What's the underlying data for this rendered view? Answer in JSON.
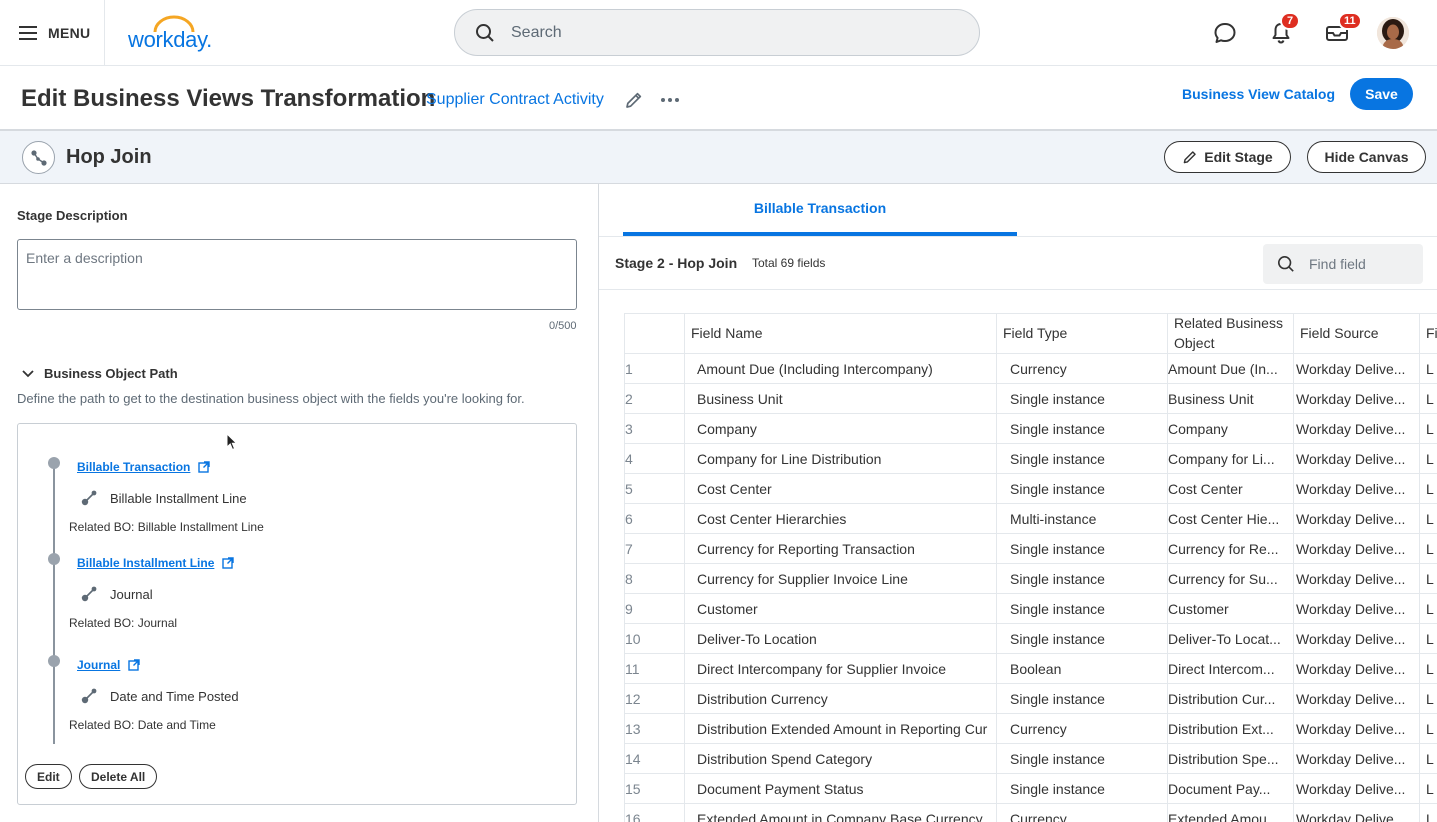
{
  "topbar": {
    "menu_label": "MENU",
    "logo_text": "workday.",
    "search_placeholder": "Search",
    "notifications_count": "7",
    "inbox_count": "11"
  },
  "header": {
    "title": "Edit Business Views Transformation",
    "subtitle": "Supplier Contract Activity",
    "catalog_link": "Business View Catalog",
    "save_label": "Save"
  },
  "stage": {
    "title": "Hop Join",
    "edit_label": "Edit Stage",
    "hide_label": "Hide Canvas"
  },
  "left": {
    "stage_desc_label": "Stage Description",
    "desc_placeholder": "Enter a description",
    "counter": "0/500",
    "bop_title": "Business Object Path",
    "bop_desc": "Define the path to get to the destination business object with the fields you're looking for.",
    "path": [
      {
        "link": "Billable Transaction",
        "relation": "Billable Installment Line",
        "related_bo": "Related BO: Billable Installment Line"
      },
      {
        "link": "Billable Installment Line",
        "relation": "Journal",
        "related_bo": "Related BO: Journal"
      },
      {
        "link": "Journal",
        "relation": "Date and Time Posted",
        "related_bo": "Related BO: Date and Time"
      }
    ],
    "edit_label": "Edit",
    "delete_label": "Delete All"
  },
  "right": {
    "tab": "Billable Transaction",
    "stage_name": "Stage 2 - Hop Join",
    "total_fields": "Total 69 fields",
    "find_placeholder": "Find field",
    "columns": [
      "Field Name",
      "Field Type",
      "Related Business Object",
      "Field Source",
      "Fi"
    ],
    "rows": [
      {
        "n": "1",
        "name": "Amount Due (Including Intercompany)",
        "type": "Currency",
        "rel": "Amount Due (In...",
        "src": "Workday Delive...",
        "more": "L"
      },
      {
        "n": "2",
        "name": "Business Unit",
        "type": "Single instance",
        "rel": "Business Unit",
        "src": "Workday Delive...",
        "more": "L"
      },
      {
        "n": "3",
        "name": "Company",
        "type": "Single instance",
        "rel": "Company",
        "src": "Workday Delive...",
        "more": "L"
      },
      {
        "n": "4",
        "name": "Company for Line Distribution",
        "type": "Single instance",
        "rel": "Company for Li...",
        "src": "Workday Delive...",
        "more": "L"
      },
      {
        "n": "5",
        "name": "Cost Center",
        "type": "Single instance",
        "rel": "Cost Center",
        "src": "Workday Delive...",
        "more": "L"
      },
      {
        "n": "6",
        "name": "Cost Center Hierarchies",
        "type": "Multi-instance",
        "rel": "Cost Center Hie...",
        "src": "Workday Delive...",
        "more": "L"
      },
      {
        "n": "7",
        "name": "Currency for Reporting Transaction",
        "type": "Single instance",
        "rel": "Currency for Re...",
        "src": "Workday Delive...",
        "more": "L"
      },
      {
        "n": "8",
        "name": "Currency for Supplier Invoice Line",
        "type": "Single instance",
        "rel": "Currency for Su...",
        "src": "Workday Delive...",
        "more": "L"
      },
      {
        "n": "9",
        "name": "Customer",
        "type": "Single instance",
        "rel": "Customer",
        "src": "Workday Delive...",
        "more": "L"
      },
      {
        "n": "10",
        "name": "Deliver-To Location",
        "type": "Single instance",
        "rel": "Deliver-To Locat...",
        "src": "Workday Delive...",
        "more": "L"
      },
      {
        "n": "11",
        "name": "Direct Intercompany for Supplier Invoice",
        "type": "Boolean",
        "rel": "Direct Intercom...",
        "src": "Workday Delive...",
        "more": "L"
      },
      {
        "n": "12",
        "name": "Distribution Currency",
        "type": "Single instance",
        "rel": "Distribution Cur...",
        "src": "Workday Delive...",
        "more": "L"
      },
      {
        "n": "13",
        "name": "Distribution Extended Amount in Reporting Cur",
        "type": "Currency",
        "rel": "Distribution Ext...",
        "src": "Workday Delive...",
        "more": "L"
      },
      {
        "n": "14",
        "name": "Distribution Spend Category",
        "type": "Single instance",
        "rel": "Distribution Spe...",
        "src": "Workday Delive...",
        "more": "L"
      },
      {
        "n": "15",
        "name": "Document Payment Status",
        "type": "Single instance",
        "rel": "Document Pay...",
        "src": "Workday Delive...",
        "more": "L"
      },
      {
        "n": "16",
        "name": "Extended Amount in Company Base Currency",
        "type": "Currency",
        "rel": "Extended Amou...",
        "src": "Workday Delive...",
        "more": "L"
      }
    ]
  }
}
